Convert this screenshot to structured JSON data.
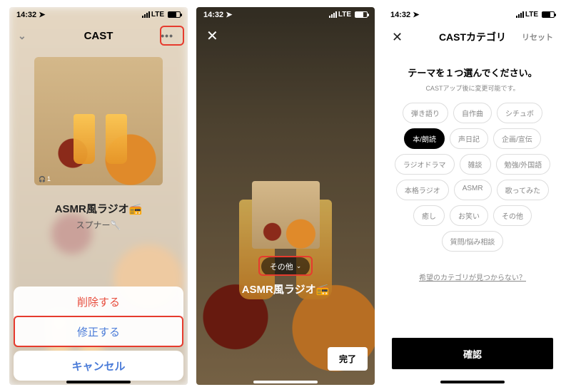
{
  "status": {
    "time": "14:32",
    "network": "LTE"
  },
  "screen1": {
    "title": "CAST",
    "card_plays": "1",
    "cast_title": "ASMR風ラジオ📻",
    "author": "スプナー🥄",
    "sheet": {
      "delete": "削除する",
      "edit": "修正する",
      "cancel": "キャンセル"
    }
  },
  "screen2": {
    "chip_label": "その他",
    "title": "ASMR風ラジオ📻",
    "done": "完了"
  },
  "screen3": {
    "title": "CASTカテゴリ",
    "reset": "リセット",
    "heading": "テーマを１つ選んでください。",
    "sub": "CASTアップ後に変更可能です。",
    "categories": [
      {
        "label": "弾き語り",
        "sel": false
      },
      {
        "label": "自作曲",
        "sel": false
      },
      {
        "label": "シチュボ",
        "sel": false
      },
      {
        "label": "本/朗読",
        "sel": true
      },
      {
        "label": "声日記",
        "sel": false
      },
      {
        "label": "企画/宣伝",
        "sel": false
      },
      {
        "label": "ラジオドラマ",
        "sel": false
      },
      {
        "label": "雑談",
        "sel": false
      },
      {
        "label": "勉強/外国語",
        "sel": false
      },
      {
        "label": "本格ラジオ",
        "sel": false
      },
      {
        "label": "ASMR",
        "sel": false
      },
      {
        "label": "歌ってみた",
        "sel": false
      },
      {
        "label": "癒し",
        "sel": false
      },
      {
        "label": "お笑い",
        "sel": false
      },
      {
        "label": "その他",
        "sel": false
      },
      {
        "label": "質問/悩み相談",
        "sel": false
      }
    ],
    "link": "希望のカテゴリが見つからない？",
    "confirm": "確認"
  }
}
